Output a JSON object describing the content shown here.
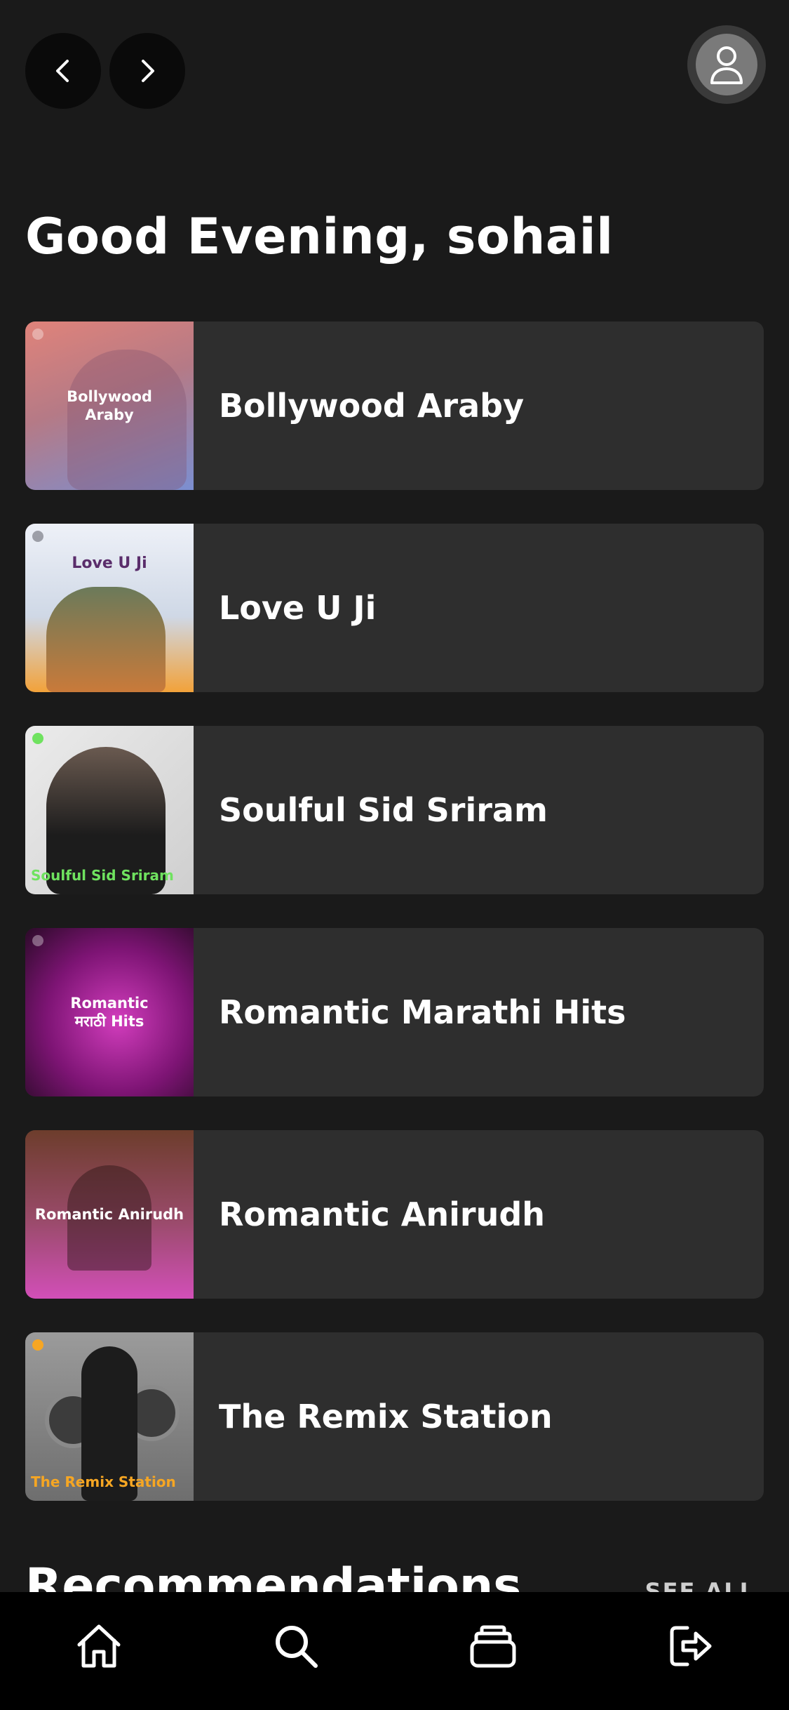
{
  "greeting": "Good Evening, sohail",
  "playlists": [
    {
      "title": "Bollywood Araby",
      "cover_text": "Bollywood\nAraby"
    },
    {
      "title": "Love U Ji",
      "cover_text": "Love U Ji"
    },
    {
      "title": "Soulful Sid Sriram",
      "cover_text": "Soulful Sid Sriram"
    },
    {
      "title": "Romantic Marathi Hits",
      "cover_text": "Romantic\nमराठी Hits"
    },
    {
      "title": "Romantic Anirudh",
      "cover_text": "Romantic Anirudh"
    },
    {
      "title": "The Remix Station",
      "cover_text": "The Remix Station"
    }
  ],
  "recommendations": {
    "title": "Recommendations",
    "see_all": "SEE ALL"
  },
  "icons": {
    "back": "chevron-left-icon",
    "forward": "chevron-right-icon",
    "profile": "user-icon",
    "home": "home-icon",
    "search": "search-icon",
    "library": "library-icon",
    "logout": "logout-icon"
  },
  "colors": {
    "background": "#1a1a1a",
    "card": "#2e2e2e",
    "nav_bar": "#000000",
    "text": "#ffffff",
    "cover_accent_green": "#6fe25f",
    "cover_accent_orange": "#f6a623"
  }
}
